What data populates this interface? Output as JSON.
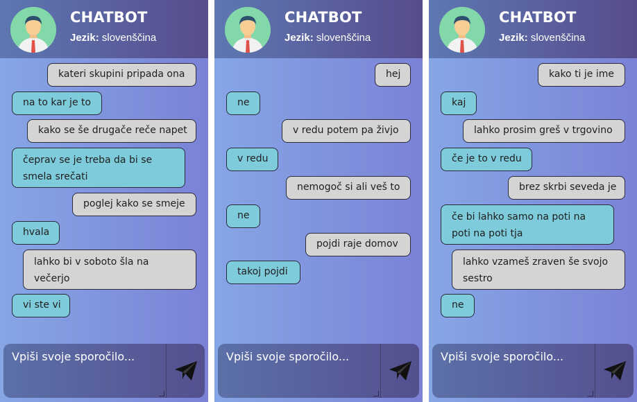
{
  "panels": [
    {
      "title": "CHATBOT",
      "language_label": "Jezik:",
      "language_value": "slovenščina",
      "input_placeholder": "Vpiši svoje sporočilo...",
      "messages": [
        {
          "sender": "user",
          "text": "kateri skupini pripada ona"
        },
        {
          "sender": "bot",
          "text": "na to kar je to"
        },
        {
          "sender": "user",
          "text": "kako se še drugače reče napet"
        },
        {
          "sender": "bot",
          "text": "čeprav se je treba da bi se smela srečati"
        },
        {
          "sender": "user",
          "text": "poglej kako se smeje"
        },
        {
          "sender": "bot",
          "text": "hvala"
        },
        {
          "sender": "user",
          "text": "lahko bi v soboto šla na večerjo"
        },
        {
          "sender": "bot",
          "text": "vi ste vi"
        }
      ]
    },
    {
      "title": "CHATBOT",
      "language_label": "Jezik:",
      "language_value": "slovenščina",
      "input_placeholder": "Vpiši svoje sporočilo...",
      "messages": [
        {
          "sender": "user",
          "text": "hej"
        },
        {
          "sender": "bot",
          "text": "ne"
        },
        {
          "sender": "user",
          "text": "v redu potem pa živjo"
        },
        {
          "sender": "bot",
          "text": "v redu"
        },
        {
          "sender": "user",
          "text": "nemogoč si ali veš to"
        },
        {
          "sender": "bot",
          "text": "ne"
        },
        {
          "sender": "user",
          "text": "pojdi raje domov"
        },
        {
          "sender": "bot",
          "text": "takoj pojdi"
        }
      ]
    },
    {
      "title": "CHATBOT",
      "language_label": "Jezik:",
      "language_value": "slovenščina",
      "input_placeholder": "Vpiši svoje sporočilo...",
      "messages": [
        {
          "sender": "user",
          "text": "kako ti je ime"
        },
        {
          "sender": "bot",
          "text": "kaj"
        },
        {
          "sender": "user",
          "text": "lahko prosim greš v trgovino"
        },
        {
          "sender": "bot",
          "text": "če je to v redu"
        },
        {
          "sender": "user",
          "text": "brez skrbi seveda je"
        },
        {
          "sender": "bot",
          "text": "če bi lahko samo na poti na poti na poti tja"
        },
        {
          "sender": "user",
          "text": "lahko vzameš zraven še svojo sestro"
        },
        {
          "sender": "bot",
          "text": "ne"
        }
      ]
    }
  ],
  "icons": {
    "avatar": "avatar-icon",
    "send": "paper-plane-icon"
  },
  "colors": {
    "user_bubble": "#d4d4d4",
    "bot_bubble": "#7ecbdb",
    "header": "#5a66a0"
  }
}
